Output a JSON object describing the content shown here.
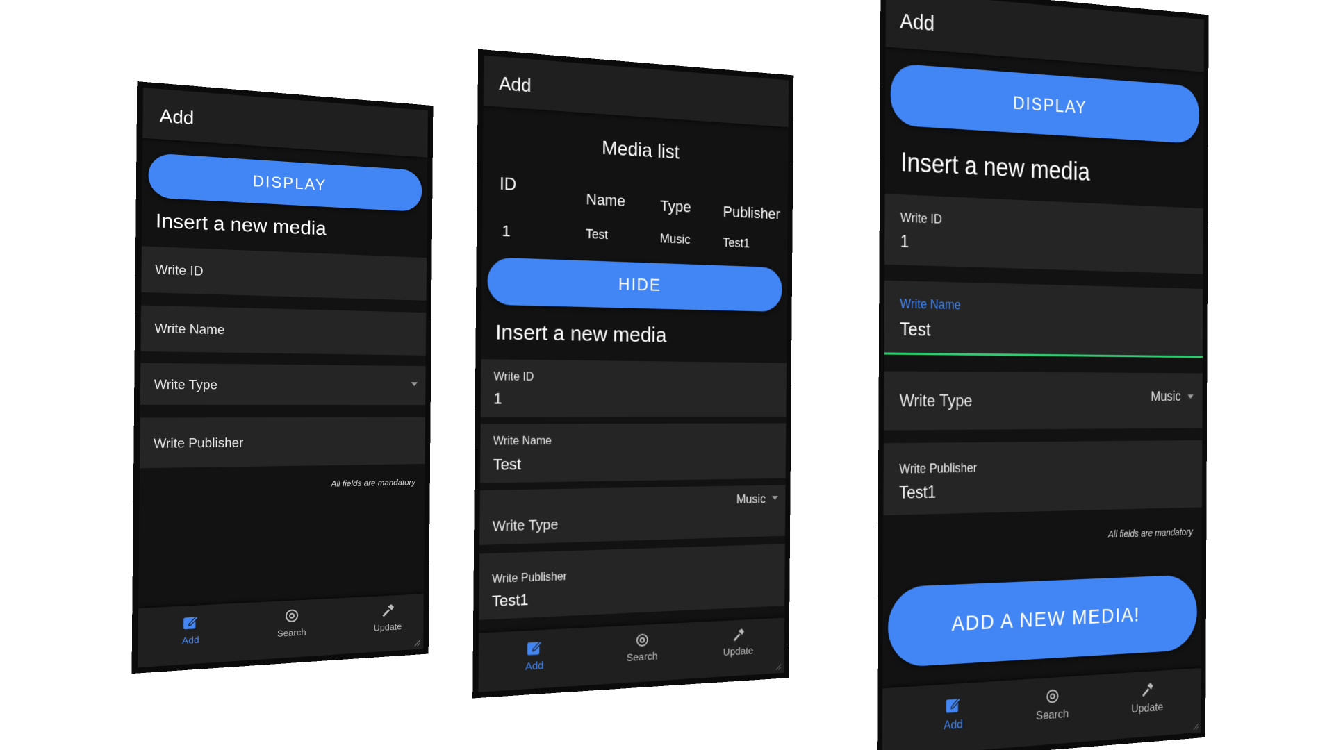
{
  "screens": [
    {
      "appbar_title": "Add",
      "display_button": "DISPLAY",
      "section_title": "Insert a new media",
      "fields": {
        "id_label": "Write ID",
        "name_label": "Write Name",
        "type_label": "Write Type",
        "publisher_label": "Write Publisher"
      },
      "note": "All fields are mandatory",
      "nav": {
        "add": "Add",
        "search": "Search",
        "update": "Update"
      }
    },
    {
      "appbar_title": "Add",
      "table": {
        "title": "Media list",
        "headers": [
          "ID",
          "Name",
          "Type",
          "Publisher"
        ],
        "rows": [
          [
            "1",
            "Test",
            "Music",
            "Test1"
          ]
        ]
      },
      "hide_button": "HIDE",
      "section_title": "Insert a new media",
      "fields": {
        "id_label": "Write ID",
        "id_value": "1",
        "name_label": "Write Name",
        "name_value": "Test",
        "type_label": "Write Type",
        "type_value": "Music",
        "publisher_label": "Write Publisher",
        "publisher_value": "Test1"
      },
      "nav": {
        "add": "Add",
        "search": "Search",
        "update": "Update"
      }
    },
    {
      "appbar_title": "Add",
      "display_button": "DISPLAY",
      "section_title": "Insert a new media",
      "fields": {
        "id_label": "Write ID",
        "id_value": "1",
        "name_label": "Write Name",
        "name_value": "Test",
        "type_label": "Write Type",
        "type_value": "Music",
        "publisher_label": "Write Publisher",
        "publisher_value": "Test1"
      },
      "note": "All fields are mandatory",
      "add_button": "ADD A NEW MEDIA!",
      "nav": {
        "add": "Add",
        "search": "Search",
        "update": "Update"
      }
    }
  ],
  "colors": {
    "accent": "#4285f4",
    "focus_underline": "#2ecc71",
    "background": "#121212",
    "surface": "#252525",
    "appbar": "#1f1f1f"
  }
}
